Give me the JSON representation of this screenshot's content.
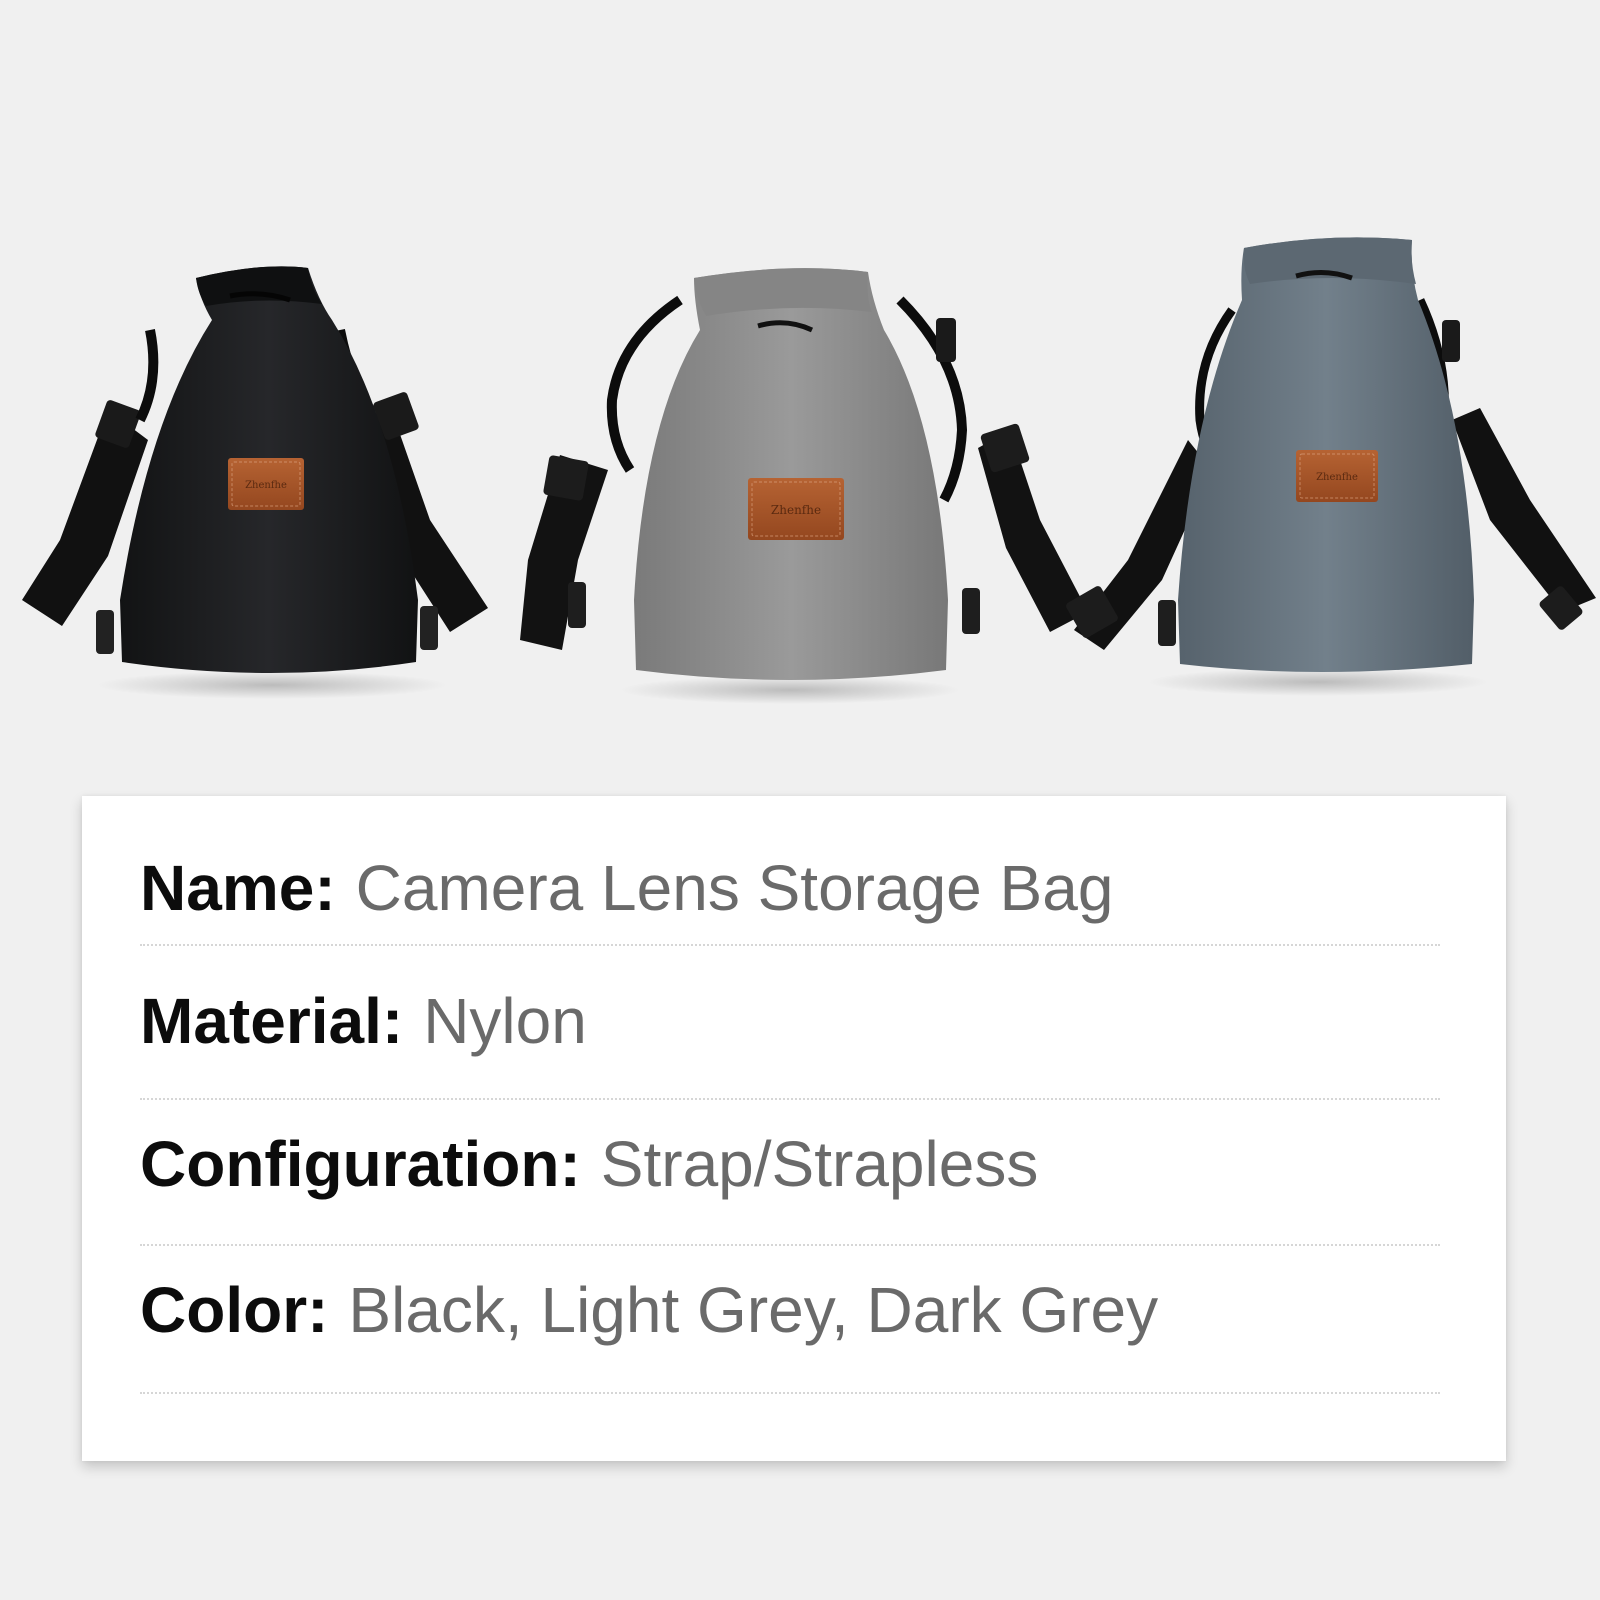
{
  "colors": {
    "background": "#f0f0f0",
    "card": "#ffffff",
    "label": "#0c0c0c",
    "value": "#6a6a6a",
    "bag_black": "#1e1f20",
    "bag_light_grey": "#8e8e8e",
    "bag_dark_grey": "#66717b",
    "leather_patch": "#a9582e"
  },
  "products": [
    {
      "color": "Black",
      "patch_text": "Zhenfhe"
    },
    {
      "color": "Light Grey",
      "patch_text": "Zhenfhe"
    },
    {
      "color": "Dark Grey",
      "patch_text": "Zhenfhe"
    }
  ],
  "specs": [
    {
      "label": "Name:",
      "value": "Camera Lens Storage Bag"
    },
    {
      "label": "Material:",
      "value": "Nylon"
    },
    {
      "label": "Configuration:",
      "value": "Strap/Strapless"
    },
    {
      "label": "Color:",
      "value": "Black, Light Grey, Dark Grey"
    }
  ]
}
